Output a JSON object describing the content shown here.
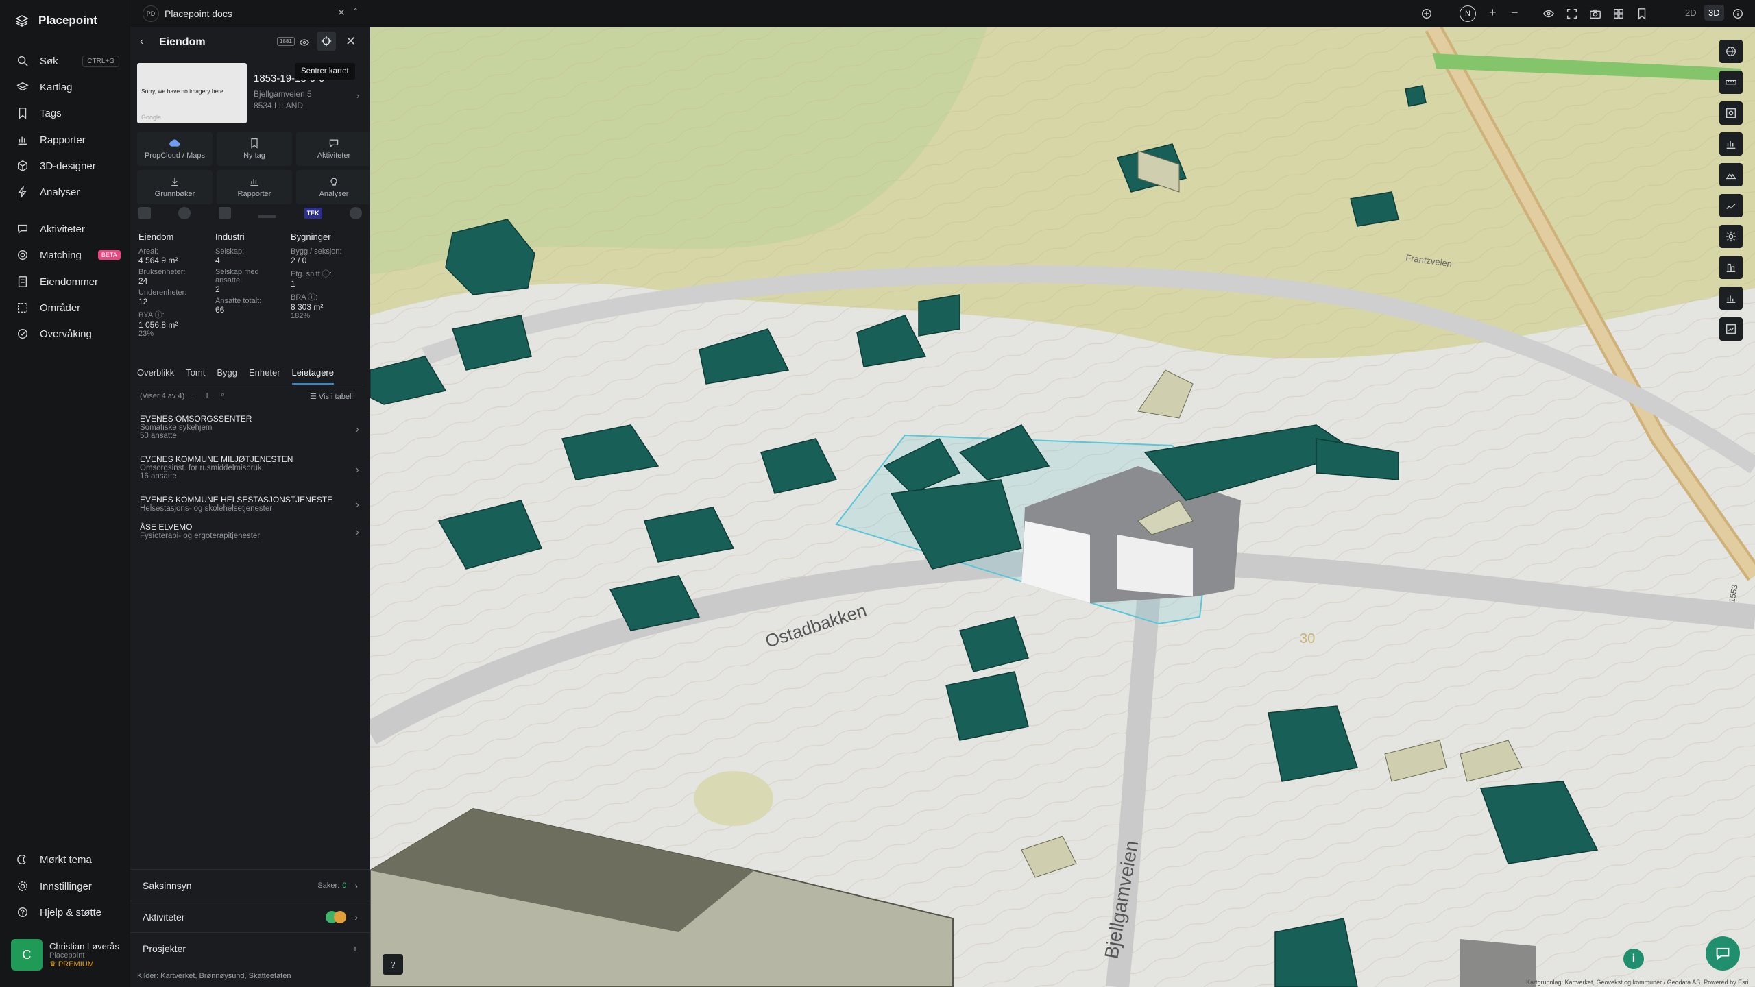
{
  "app": {
    "name": "Placepoint"
  },
  "nav": {
    "items": [
      {
        "label": "Søk",
        "shortcut": "CTRL+G"
      },
      {
        "label": "Kartlag"
      },
      {
        "label": "Tags"
      },
      {
        "label": "Rapporter"
      },
      {
        "label": "3D-designer"
      },
      {
        "label": "Analyser"
      },
      {
        "label": "Aktiviteter"
      },
      {
        "label": "Matching",
        "badge": "BETA"
      },
      {
        "label": "Eiendommer"
      },
      {
        "label": "Områder"
      },
      {
        "label": "Overvåking"
      }
    ],
    "bottom": [
      {
        "label": "Mørkt tema"
      },
      {
        "label": "Innstillinger"
      },
      {
        "label": "Hjelp & støtte"
      }
    ],
    "user": {
      "initial": "C",
      "name": "Christian Løverås",
      "org": "Placepoint",
      "plan": "PREMIUM"
    }
  },
  "docs_tab": {
    "initials": "PD",
    "label": "Placepoint docs"
  },
  "topbar": {
    "mode_2d": "2D",
    "mode_3d": "3D",
    "compass": "N"
  },
  "panel": {
    "title": "Eiendom",
    "badge": "1881",
    "tooltip": "Sentrer kartet",
    "imagery_text": "Sorry, we have no imagery here.",
    "google_text": "Google",
    "property_id": "1853-19-18-0-0",
    "address_line1": "Bjellgamveien 5",
    "address_line2": "8534 LILAND",
    "actions": [
      {
        "label": "PropCloud / Maps"
      },
      {
        "label": "Ny tag"
      },
      {
        "label": "Aktiviteter"
      },
      {
        "label": "Grunnbøker"
      },
      {
        "label": "Rapporter"
      },
      {
        "label": "Analyser"
      }
    ],
    "layer_chip_tek": "TEK",
    "stats": {
      "eiendom": {
        "heading": "Eiendom",
        "areal_label": "Areal:",
        "areal": "4 564.9 m²",
        "bruks_label": "Bruksenheter:",
        "bruks": "24",
        "under_label": "Underenheter:",
        "under": "12",
        "bya_label": "BYA ⓘ:",
        "bya": "1 056.8 m²",
        "bya_pct": "23%"
      },
      "industri": {
        "heading": "Industri",
        "selskap_label": "Selskap:",
        "selskap": "4",
        "ansatte_label": "Selskap med ansatte:",
        "ansatte": "2",
        "totalt_label": "Ansatte totalt:",
        "totalt": "66"
      },
      "bygninger": {
        "heading": "Bygninger",
        "bygg_label": "Bygg / seksjon:",
        "bygg": "2 / 0",
        "etg_label": "Etg. snitt ⓘ:",
        "etg": "1",
        "bra_label": "BRA ⓘ:",
        "bra": "8 303 m²",
        "bra_pct": "182%"
      }
    },
    "tabs": [
      "Overblikk",
      "Tomt",
      "Bygg",
      "Enheter",
      "Leietagere"
    ],
    "list_count": "(Viser 4 av 4)",
    "table_toggle": "Vis i tabell",
    "tenants": [
      {
        "name": "EVENES OMSORGSSENTER",
        "sub": "Somatiske sykehjem",
        "emp": "50 ansatte"
      },
      {
        "name": "EVENES KOMMUNE MILJØTJENESTEN",
        "sub": "Omsorgsinst. for rusmiddelmisbruk.",
        "emp": "16 ansatte"
      },
      {
        "name": "EVENES KOMMUNE HELSESTASJONSTJENESTE",
        "sub": "Helsestasjons- og skolehelsetjenester",
        "emp": ""
      },
      {
        "name": "ÅSE ELVEMO",
        "sub": "Fysioterapi- og ergoterapitjenester",
        "emp": ""
      }
    ],
    "sections": {
      "saksinnsyn": "Saksinnsyn",
      "saker_label": "Saker:",
      "saker": "0",
      "aktiviteter": "Aktiviteter",
      "prosjekter": "Prosjekter"
    },
    "sources": {
      "label": "Kilder:",
      "items": [
        "Kartverket",
        "Brønnøysund",
        "Skatteetaten"
      ]
    }
  },
  "map": {
    "labels": {
      "road1": "Ostadbakken",
      "road2": "Bjellgamveien",
      "road3": "Frantzveien",
      "contour": "30",
      "sign": "1553"
    },
    "attribution": "Kartgrunnlag: Kartverket, Geovekst og kommuner / Geodata AS. Powered by Esri",
    "help": "?"
  },
  "colors": {
    "accent": "#2f87d8",
    "building": "#175f57",
    "selection": "#5bc6d6",
    "chat": "#1f8f6e",
    "premium": "#e2a21b"
  }
}
